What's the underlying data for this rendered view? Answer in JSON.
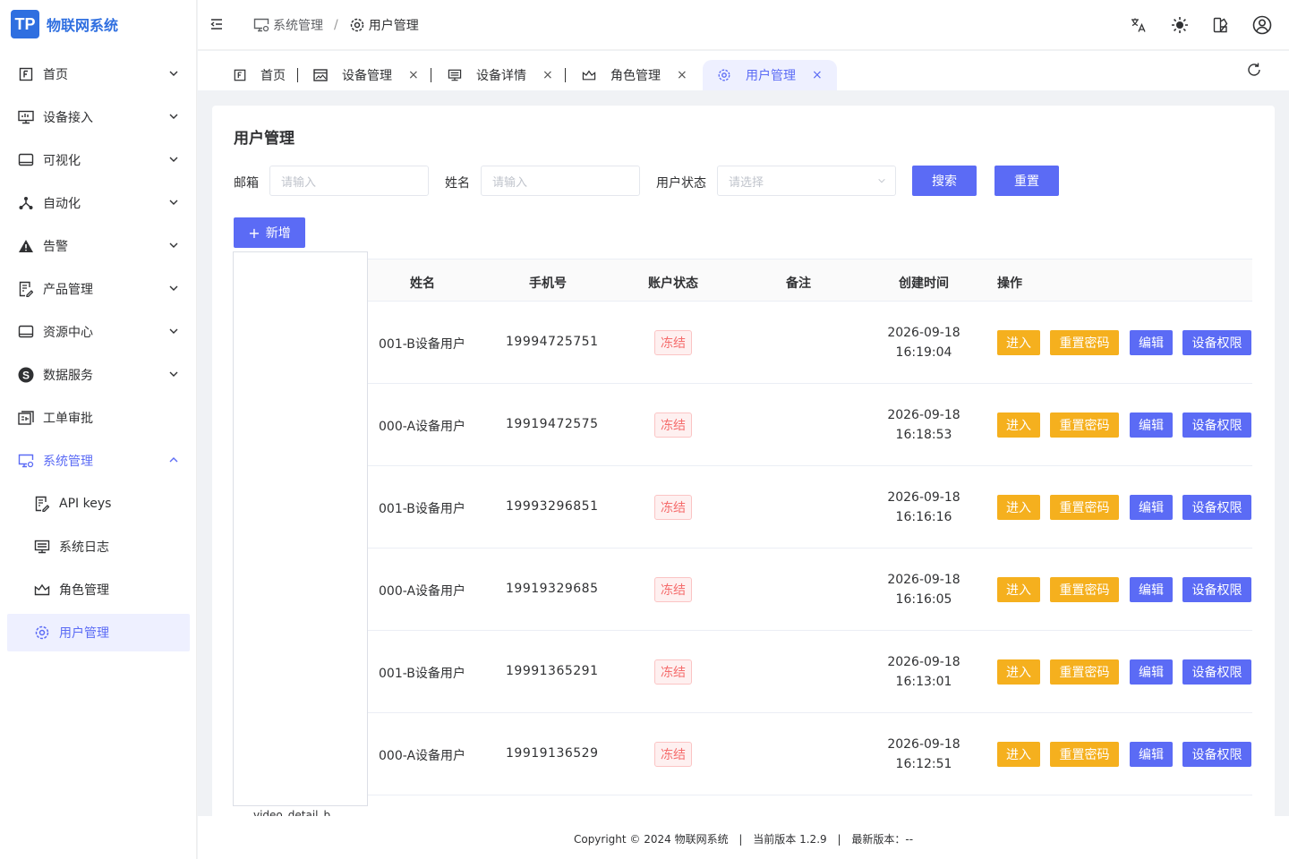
{
  "app": {
    "logo_letter": "TP",
    "title": "物联网系统"
  },
  "sidebar": {
    "items": [
      {
        "label": "首页",
        "icon": "home-icon"
      },
      {
        "label": "设备接入",
        "icon": "monitor-icon"
      },
      {
        "label": "可视化",
        "icon": "screen-icon"
      },
      {
        "label": "自动化",
        "icon": "flow-icon"
      },
      {
        "label": "告警",
        "icon": "warning-icon"
      },
      {
        "label": "产品管理",
        "icon": "doc-edit-icon"
      },
      {
        "label": "资源中心",
        "icon": "screen-icon"
      },
      {
        "label": "数据服务",
        "icon": "data-service-icon"
      },
      {
        "label": "工单审批",
        "icon": "approval-icon"
      },
      {
        "label": "系统管理",
        "icon": "system-icon"
      }
    ],
    "sub_items": [
      {
        "label": "API keys"
      },
      {
        "label": "系统日志"
      },
      {
        "label": "角色管理"
      },
      {
        "label": "用户管理"
      }
    ]
  },
  "header": {
    "breadcrumb": [
      "系统管理",
      "用户管理"
    ],
    "breadcrumb_sep": "/"
  },
  "tabs": [
    {
      "label": "首页"
    },
    {
      "label": "设备管理"
    },
    {
      "label": "设备详情"
    },
    {
      "label": "角色管理"
    },
    {
      "label": "用户管理"
    }
  ],
  "tab_close": "×",
  "page": {
    "title": "用户管理",
    "filters": {
      "email_label": "邮箱",
      "email_placeholder": "请输入",
      "name_label": "姓名",
      "name_placeholder": "请输入",
      "status_label": "用户状态",
      "status_placeholder": "请选择"
    },
    "search_label": "搜索",
    "reset_label": "重置",
    "add_label": "新增",
    "video_caption": "video_detail_b"
  },
  "table": {
    "columns": [
      "姓名",
      "手机号",
      "账户状态",
      "备注",
      "创建时间",
      "操作"
    ],
    "rows": [
      {
        "name": "001-B设备用户",
        "phone": "19994725751",
        "status": "冻结",
        "date": "2026-09-18",
        "time": "16:19:04"
      },
      {
        "name": "000-A设备用户",
        "phone": "19919472575",
        "status": "冻结",
        "date": "2026-09-18",
        "time": "16:18:53"
      },
      {
        "name": "001-B设备用户",
        "phone": "19993296851",
        "status": "冻结",
        "date": "2026-09-18",
        "time": "16:16:16"
      },
      {
        "name": "000-A设备用户",
        "phone": "19919329685",
        "status": "冻结",
        "date": "2026-09-18",
        "time": "16:16:05"
      },
      {
        "name": "001-B设备用户",
        "phone": "19991365291",
        "status": "冻结",
        "date": "2026-09-18",
        "time": "16:13:01"
      },
      {
        "name": "000-A设备用户",
        "phone": "19919136529",
        "status": "冻结",
        "date": "2026-09-18",
        "time": "16:12:51"
      }
    ],
    "actions": {
      "enter": "进入",
      "reset_pwd": "重置密码",
      "edit": "编辑",
      "perm": "设备权限"
    }
  },
  "footer": {
    "copyright": "Copyright © 2024 物联网系统",
    "current_version": "当前版本 1.2.9",
    "latest_version": "最新版本：--",
    "sep": "|"
  },
  "colors": {
    "primary": "#5b6bf5",
    "warning": "#f5b01e",
    "danger": "#f56c6c",
    "logo": "#2f6fe0"
  }
}
